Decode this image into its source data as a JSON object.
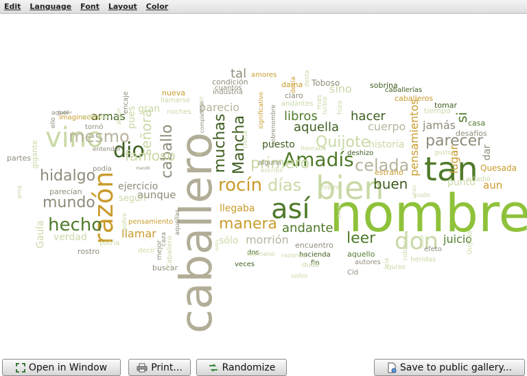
{
  "menu": [
    "Edit",
    "Language",
    "Font",
    "Layout",
    "Color"
  ],
  "buttons": {
    "open_window": "Open in Window",
    "print": "Print...",
    "randomize": "Randomize",
    "save_gallery": "Save to public gallery..."
  },
  "colors": {
    "beige": "#b7b39c",
    "grey": "#8f8b7a",
    "olive": "#7a8a3c",
    "green": "#4f7a2a",
    "dark_green": "#3d5d1f",
    "lime": "#8fc23b",
    "light_green": "#c9d9a6",
    "gold": "#c99b2b",
    "pale": "#dde5cf"
  },
  "words": [
    {
      "text": "nombre",
      "color": "#8fc23b"
    },
    {
      "text": "caballero",
      "color": "#b2ad97"
    },
    {
      "text": "así",
      "color": "#4f7a2a"
    },
    {
      "text": "bien",
      "color": "#c9d9a6"
    },
    {
      "text": "tan",
      "color": "#4f7a2a"
    },
    {
      "text": "don",
      "color": "#c9d9a6"
    },
    {
      "text": "razón",
      "color": "#c99b2b"
    },
    {
      "text": "vino",
      "color": "#c9d9a6"
    },
    {
      "text": "Amadís",
      "color": "#4f7a2a"
    },
    {
      "text": "celada",
      "color": "#b7b39c"
    },
    {
      "text": "rocín",
      "color": "#c99b2b"
    },
    {
      "text": "hecho",
      "color": "#4f7a2a"
    },
    {
      "text": "dio",
      "color": "#3d5d1f"
    },
    {
      "text": "mesmo",
      "color": "#b7b39c"
    },
    {
      "text": "hidalgo",
      "color": "#8f8b7a"
    },
    {
      "text": "mundo",
      "color": "#8f8b7a"
    },
    {
      "text": "manera",
      "color": "#c99b2b"
    },
    {
      "text": "leer",
      "color": "#4f7a2a"
    },
    {
      "text": "parecer",
      "color": "#8f8b7a"
    },
    {
      "text": "Mancha",
      "color": "#3d5d1f"
    },
    {
      "text": "muchas",
      "color": "#3d5d1f"
    },
    {
      "text": "caballo",
      "color": "#8f8b7a"
    },
    {
      "text": "famoso",
      "color": "#c9d9a6"
    },
    {
      "text": "señora",
      "color": "#c9d9a6"
    },
    {
      "text": "días",
      "color": "#c9d9a6"
    },
    {
      "text": "primero",
      "color": "#c9d9a6"
    },
    {
      "text": "Quijote",
      "color": "#c9d9a6"
    },
    {
      "text": "buen",
      "color": "#3d5d1f"
    },
    {
      "text": "libros",
      "color": "#4f7a2a"
    },
    {
      "text": "aquella",
      "color": "#3d5d1f"
    },
    {
      "text": "hacer",
      "color": "#3d5d1f"
    },
    {
      "text": "cuerpo",
      "color": "#b7b39c"
    },
    {
      "text": "jamás",
      "color": "#8f8b7a"
    },
    {
      "text": "historia",
      "color": "#c9d9a6"
    },
    {
      "text": "pensamientos",
      "color": "#c99b2b"
    },
    {
      "text": "lugar",
      "color": "#c99b2b"
    },
    {
      "text": "si",
      "color": "#4f7a2a"
    },
    {
      "text": "dar",
      "color": "#8f8b7a"
    },
    {
      "text": "punto",
      "color": "#c9d9a6"
    },
    {
      "text": "aun",
      "color": "#c99b2b"
    },
    {
      "text": "Quesada",
      "color": "#c99b2b"
    },
    {
      "text": "juicio",
      "color": "#4f7a2a"
    },
    {
      "text": "andante",
      "color": "#4f7a2a"
    },
    {
      "text": "llegaba",
      "color": "#c99b2b"
    },
    {
      "text": "morrión",
      "color": "#b7b39c"
    },
    {
      "text": "sólo",
      "color": "#c9d9a6"
    },
    {
      "text": "llamar",
      "color": "#c99b2b"
    },
    {
      "text": "aunque",
      "color": "#8f8b7a"
    },
    {
      "text": "ejercicio",
      "color": "#8f8b7a"
    },
    {
      "text": "según",
      "color": "#c9d9a6"
    },
    {
      "text": "verdad",
      "color": "#c9d9a6"
    },
    {
      "text": "armas",
      "color": "#3d5d1f"
    },
    {
      "text": "gran",
      "color": "#c9d9a6"
    },
    {
      "text": "pues",
      "color": "#c9d9a6"
    },
    {
      "text": "parecían",
      "color": "#8f8b7a"
    },
    {
      "text": "puesto",
      "color": "#3d5d1f"
    },
    {
      "text": "parecio",
      "color": "#b7b39c"
    },
    {
      "text": "nueva",
      "color": "#c99b2b"
    },
    {
      "text": "tal",
      "color": "#8f8b7a"
    },
    {
      "text": "sino",
      "color": "#c9d9a6"
    },
    {
      "text": "Gaula",
      "color": "#c9d9a6"
    },
    {
      "text": "partes",
      "color": "#8f8b7a"
    },
    {
      "text": "gigante",
      "color": "#c9d9a6"
    },
    {
      "text": "ama",
      "color": "#c9d9a6"
    },
    {
      "text": "rostro",
      "color": "#8f8b7a"
    },
    {
      "text": "patria",
      "color": "#c9d9a6"
    },
    {
      "text": "decir",
      "color": "#c9d9a6"
    },
    {
      "text": "buscar",
      "color": "#8f8b7a"
    },
    {
      "text": "mejor",
      "color": "#8f8b7a"
    },
    {
      "text": "pensamiento",
      "color": "#c99b2b"
    },
    {
      "text": "encuentro",
      "color": "#8f8b7a"
    },
    {
      "text": "hacienda",
      "color": "#3d5d1f"
    },
    {
      "text": "aquello",
      "color": "#4f7a2a"
    },
    {
      "text": "autores",
      "color": "#8f8b7a"
    },
    {
      "text": "Cid",
      "color": "#8f8b7a"
    },
    {
      "text": "quiso",
      "color": "#c9d9a6"
    },
    {
      "text": "efeto",
      "color": "#8f8b7a"
    },
    {
      "text": "heridas",
      "color": "#c9d9a6"
    },
    {
      "text": "añadió",
      "color": "#c9d9a6"
    },
    {
      "text": "desafíos",
      "color": "#8f8b7a"
    },
    {
      "text": "casa",
      "color": "#4f7a2a"
    },
    {
      "text": "tiempo",
      "color": "#c9d9a6"
    },
    {
      "text": "tomar",
      "color": "#3d5d1f"
    },
    {
      "text": "caballeros",
      "color": "#c99b2b"
    },
    {
      "text": "caballerías",
      "color": "#3d5d1f"
    },
    {
      "text": "sobrina",
      "color": "#3d5d1f"
    },
    {
      "text": "Toboso",
      "color": "#8f8b7a"
    },
    {
      "text": "dama",
      "color": "#c99b2b"
    },
    {
      "text": "amores",
      "color": "#c99b2b"
    },
    {
      "text": "decía",
      "color": "#c99b2b"
    },
    {
      "text": "claro",
      "color": "#8f8b7a"
    },
    {
      "text": "andantes",
      "color": "#c9d9a6"
    },
    {
      "text": "condición",
      "color": "#8f8b7a"
    },
    {
      "text": "cuantos",
      "color": "#8f8b7a"
    },
    {
      "text": "industria",
      "color": "#8f8b7a"
    },
    {
      "text": "llamarse",
      "color": "#c9d9a6"
    },
    {
      "text": "noches",
      "color": "#c9d9a6"
    },
    {
      "text": "encaje",
      "color": "#8f8b7a"
    },
    {
      "text": "tornó",
      "color": "#8f8b7a"
    },
    {
      "text": "imaginación",
      "color": "#c99b2b"
    },
    {
      "text": "entender",
      "color": "#8f8b7a"
    },
    {
      "text": "podía",
      "color": "#8f8b7a"
    },
    {
      "text": "estraño",
      "color": "#c99b2b"
    },
    {
      "text": "deshizo",
      "color": "#3d5d1f"
    },
    {
      "text": "dos",
      "color": "#3d5d1f"
    },
    {
      "text": "veces",
      "color": "#3d5d1f"
    },
    {
      "text": "alguna",
      "color": "#8f8b7a"
    },
    {
      "text": "fin",
      "color": "#3d5d1f"
    },
    {
      "text": "señor",
      "color": "#c9d9a6"
    },
    {
      "text": "duda",
      "color": "#c9d9a6"
    },
    {
      "text": "razones",
      "color": "#c9d9a6"
    },
    {
      "text": "hermano",
      "color": "#c9d9a6"
    },
    {
      "text": "honraba",
      "color": "#c9d9a6"
    },
    {
      "text": "hizo",
      "color": "#c9d9a6"
    },
    {
      "text": "gusto",
      "color": "#c9d9a6"
    },
    {
      "text": "Quijada",
      "color": "#c9d9a6"
    },
    {
      "text": "mismo",
      "color": "#c9d9a6"
    },
    {
      "text": "ser",
      "color": "#c9d9a6"
    },
    {
      "text": "desta",
      "color": "#c9d9a6"
    },
    {
      "text": "turbio",
      "color": "#c9d9a6"
    },
    {
      "text": "mas",
      "color": "#c9d9a6"
    },
    {
      "text": "Decía",
      "color": "#c9d9a6"
    },
    {
      "text": "significativo",
      "color": "#c99b2b"
    },
    {
      "text": "sobrenombre",
      "color": "#8f8b7a"
    },
    {
      "text": "Caballero",
      "color": "#c9d9a6"
    },
    {
      "text": "caza",
      "color": "#8f8b7a"
    },
    {
      "text": "aquellas",
      "color": "#8f8b7a"
    },
    {
      "text": "pobre",
      "color": "#c9d9a6"
    },
    {
      "text": "leía",
      "color": "#c9d9a6"
    },
    {
      "text": "cobrase",
      "color": "#c9d9a6"
    },
    {
      "text": "modo",
      "color": "#c9d9a6"
    },
    {
      "text": "algún",
      "color": "#c9d9a6"
    },
    {
      "text": "aquel",
      "color": "#8f8b7a"
    },
    {
      "text": "ello",
      "color": "#8f8b7a"
    },
    {
      "text": "escribir",
      "color": "#c9d9a6"
    },
    {
      "text": "pudo",
      "color": "#c9d9a6"
    },
    {
      "text": "unas",
      "color": "#c9d9a6"
    },
    {
      "text": "ve",
      "color": "#c9d9a6"
    },
    {
      "text": "mandó",
      "color": "#8f8b7a"
    },
    {
      "text": "Galaor",
      "color": "#8f8b7a"
    },
    {
      "text": "complexión",
      "color": "#8f8b7a"
    },
    {
      "text": "deste",
      "color": "#c9d9a6"
    },
    {
      "text": "debía",
      "color": "#c9d9a6"
    },
    {
      "text": "entendió",
      "color": "#c9d9a6"
    }
  ]
}
